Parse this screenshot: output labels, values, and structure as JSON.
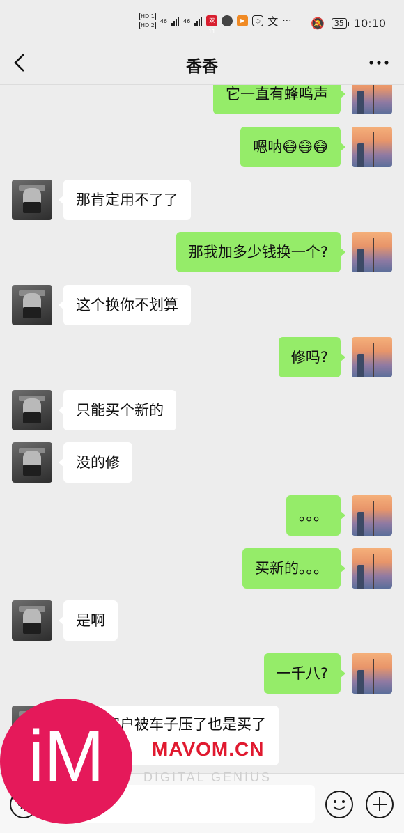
{
  "status_bar": {
    "sim1": "HD 1",
    "sim2": "HD 2",
    "net1": "46",
    "net2": "46",
    "app_badge": "双11",
    "translate_glyph": "文",
    "more_glyph": "···",
    "battery": "35",
    "time": "10:10"
  },
  "header": {
    "title": "香香",
    "back_icon": "chevron-left-icon",
    "more_icon": "more-dots-icon"
  },
  "messages": [
    {
      "side": "out",
      "text": "它一直有蜂鸣声"
    },
    {
      "side": "out",
      "text": "嗯呐😷😷😷"
    },
    {
      "side": "in",
      "text": "那肯定用不了了"
    },
    {
      "side": "out",
      "text": "那我加多少钱换一个?"
    },
    {
      "side": "in",
      "text": "这个换你不划算"
    },
    {
      "side": "out",
      "text": "修吗?"
    },
    {
      "side": "in",
      "text": "只能买个新的"
    },
    {
      "side": "in",
      "text": "没的修"
    },
    {
      "side": "out",
      "text": "。。。"
    },
    {
      "side": "out",
      "text": "买新的。。。"
    },
    {
      "side": "in",
      "text": "是啊"
    },
    {
      "side": "out",
      "text": "一千八?"
    },
    {
      "side": "in",
      "text": "有个客户被车子压了也是买了"
    }
  ],
  "input_bar": {
    "voice_icon": "voice-icon",
    "emoji_icon": "emoji-icon",
    "plus_icon": "plus-icon",
    "placeholder": ""
  },
  "watermark": {
    "logo": "iM",
    "site": "MAVOM.CN",
    "tagline": "DIGITAL GENIUS"
  },
  "colors": {
    "outgoing_bubble": "#95ec69",
    "incoming_bubble": "#ffffff",
    "background": "#ededed",
    "watermark_red": "#e5195a"
  }
}
